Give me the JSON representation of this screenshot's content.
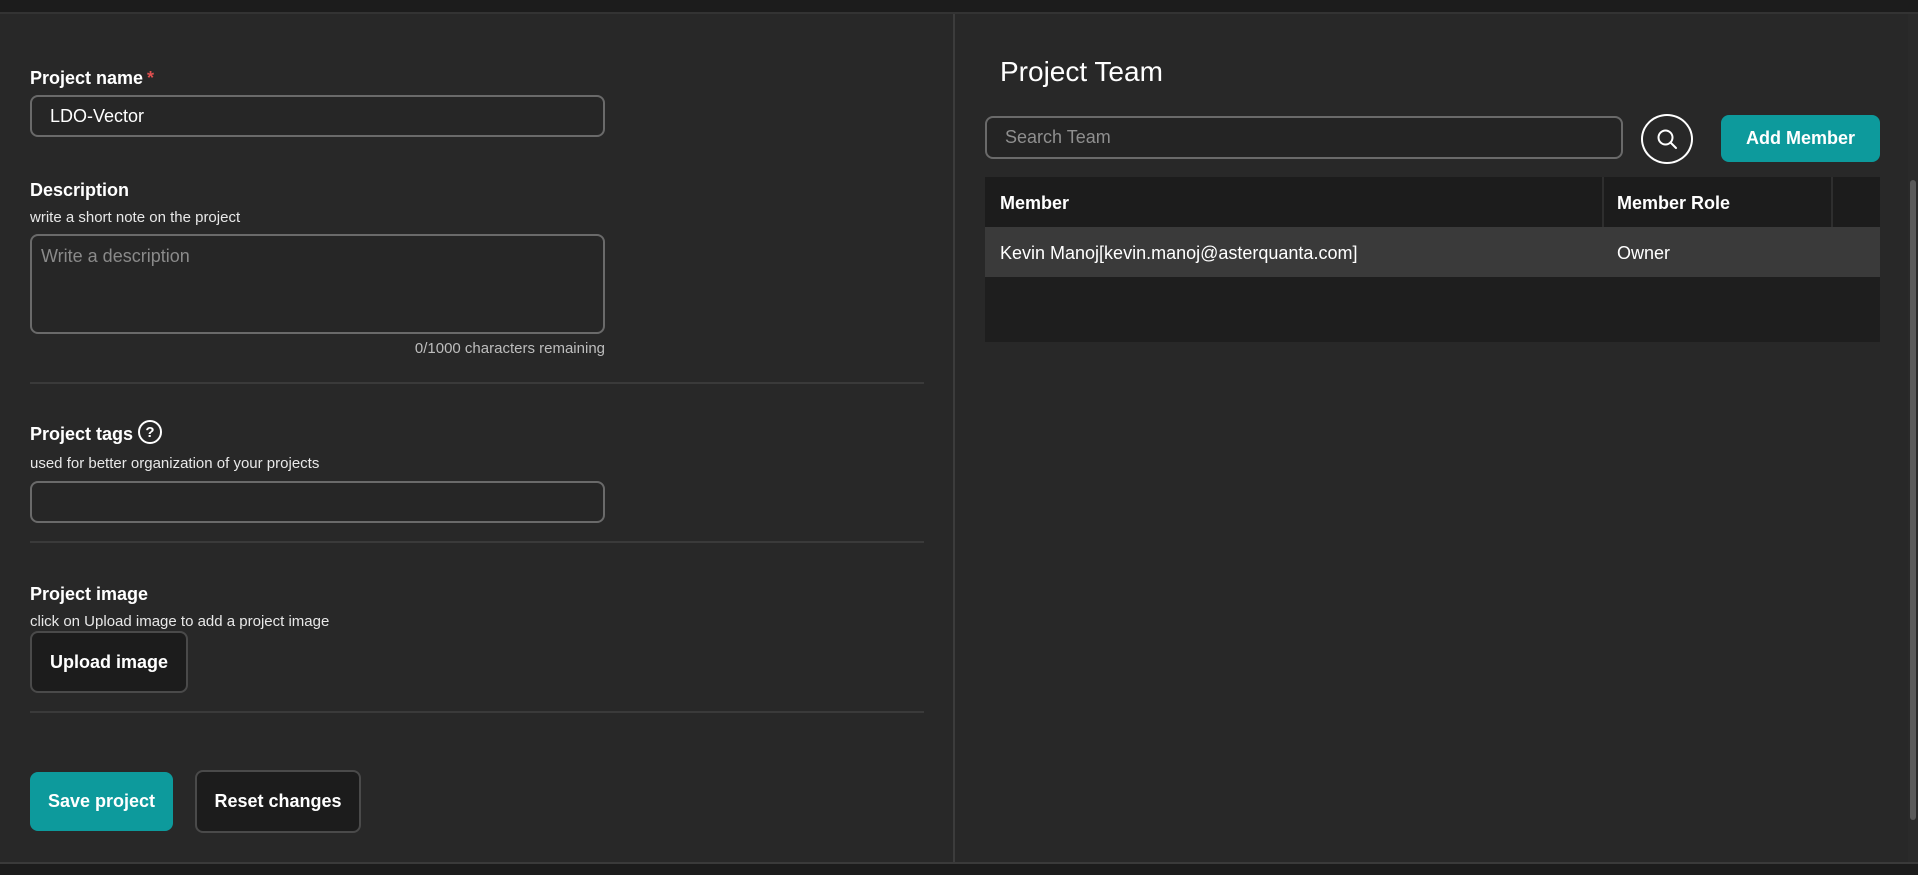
{
  "form": {
    "project_name": {
      "label": "Project name",
      "required_mark": "*",
      "value": "LDO-Vector"
    },
    "description": {
      "label": "Description",
      "help": "write a short note on the project",
      "placeholder": "Write a description",
      "char_count": "0/1000 characters remaining"
    },
    "tags": {
      "label": "Project tags",
      "help_icon_glyph": "?",
      "help": "used for better organization of your projects",
      "value": ""
    },
    "image": {
      "label": "Project image",
      "help": "click on Upload image to add a project image",
      "upload_label": "Upload image"
    },
    "save_label": "Save project",
    "reset_label": "Reset changes"
  },
  "team": {
    "title": "Project Team",
    "search_placeholder": "Search Team",
    "add_member_label": "Add Member",
    "columns": [
      "Member",
      "Member Role"
    ],
    "rows": [
      {
        "member": "Kevin Manoj[kevin.manoj@asterquanta.com]",
        "role": "Owner"
      }
    ]
  },
  "colors": {
    "accent": "#0d9a9c",
    "background": "#282828",
    "required": "#e05050"
  },
  "icons": {
    "search": "search-icon",
    "help": "help-circle-icon"
  }
}
